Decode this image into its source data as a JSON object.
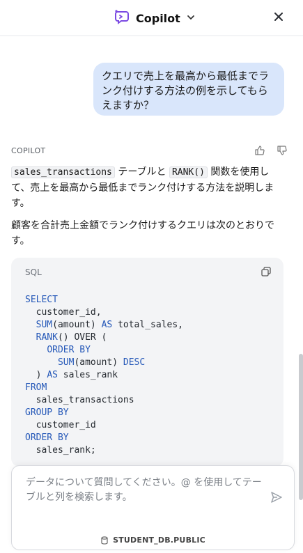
{
  "header": {
    "title": "Copilot"
  },
  "conversation": {
    "user_message": "クエリで売上を最高から最低までランク付けする方法の例を示してもらえますか？",
    "assistant_label": "COPILOT",
    "answer": {
      "code_table": "sales_transactions",
      "p1_mid": " テーブルと ",
      "code_func": "RANK()",
      "p1_end": " 関数を使用して、売上を最高から最低までランク付けする方法を説明します。",
      "p2": "顧客を合計売上金額でランク付けするクエリは次のとおりです。"
    }
  },
  "code_block": {
    "language": "SQL",
    "code": "SELECT\n  customer_id,\n  SUM(amount) AS total_sales,\n  RANK() OVER (\n    ORDER BY\n      SUM(amount) DESC\n  ) AS sales_rank\nFROM\n  sales_transactions\nGROUP BY\n  customer_id\nORDER BY\n  sales_rank;"
  },
  "composer": {
    "placeholder": "データについて質問してください。@ を使用してテーブルと列を検索します。",
    "db_context": "STUDENT_DB.PUBLIC"
  },
  "colors": {
    "user_bubble": "#d9e6fb",
    "keyword": "#2558b8",
    "accent_icon": "#7b4ae2"
  }
}
